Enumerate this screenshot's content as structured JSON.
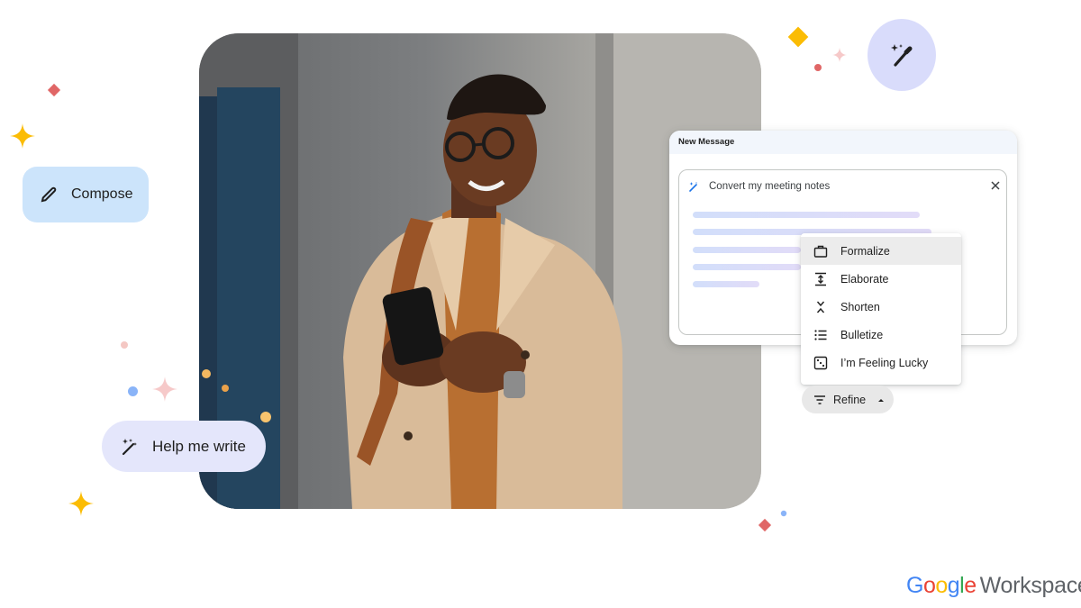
{
  "chips": {
    "compose_label": "Compose",
    "help_me_write_label": "Help me write"
  },
  "message_card": {
    "header_title": "New Message",
    "prompt_text": "Convert my meeting notes"
  },
  "refine_menu": {
    "items": [
      {
        "label": "Formalize",
        "icon": "briefcase-icon",
        "highlighted": true
      },
      {
        "label": "Elaborate",
        "icon": "expand-vertical-icon",
        "highlighted": false
      },
      {
        "label": "Shorten",
        "icon": "compress-vertical-icon",
        "highlighted": false
      },
      {
        "label": "Bulletize",
        "icon": "bulleted-list-icon",
        "highlighted": false
      },
      {
        "label": "I’m Feeling Lucky",
        "icon": "dice-icon",
        "highlighted": false
      }
    ],
    "button_label": "Refine"
  },
  "logo": {
    "letters": [
      "G",
      "o",
      "o",
      "g",
      "l",
      "e"
    ],
    "product": "Workspace"
  },
  "colors": {
    "compose_chip_bg": "#cce4fb",
    "help_chip_bg": "#e4e6fb",
    "magic_circle_bg": "#d9dcfb",
    "sparkle_yellow": "#fbbc04",
    "sparkle_red": "#e06666",
    "sparkle_pink": "#f4c7c3",
    "sparkle_blue": "#8ab4f8",
    "google_blue": "#4285f4",
    "google_red": "#ea4335",
    "google_yellow": "#fbbc04",
    "google_green": "#34a853"
  }
}
